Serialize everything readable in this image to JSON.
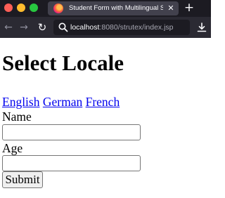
{
  "browser": {
    "tab": {
      "title": "Student Form with Multilingual Supp",
      "close_glyph": "✕",
      "favicon": "firefox-icon"
    },
    "new_tab_glyph": "+",
    "nav": {
      "back_glyph": "←",
      "forward_glyph": "→",
      "reload_glyph": "↻"
    },
    "url": {
      "host": "localhost",
      "rest": ":8080/strutex/index.jsp"
    },
    "icons": [
      "search-icon",
      "download-icon"
    ],
    "colors": {
      "tabbar_bg": "#1c1b22",
      "navbar_bg": "#2b2a33",
      "active_tab_bg": "#42414d"
    }
  },
  "page": {
    "heading": "Select Locale",
    "locales": [
      {
        "label": "English"
      },
      {
        "label": "German"
      },
      {
        "label": "French"
      }
    ],
    "form": {
      "name_label": "Name",
      "name_value": "",
      "age_label": "Age",
      "age_value": "",
      "submit_label": "Submit"
    },
    "colors": {
      "link": "#0000ee"
    }
  }
}
